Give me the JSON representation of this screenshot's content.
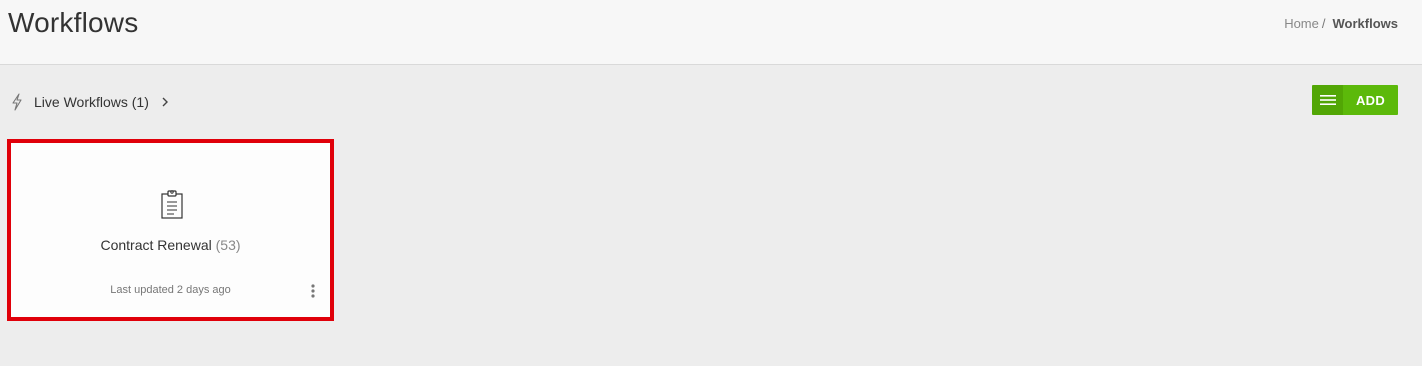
{
  "header": {
    "title": "Workflows",
    "breadcrumb": {
      "home": "Home",
      "separator": "/",
      "current": "Workflows"
    }
  },
  "toolbar": {
    "live_workflows_label": "Live Workflows (1)",
    "live_icon": "lightning-bolt-icon",
    "expand_icon": "chevron-right-icon",
    "add_label": "ADD",
    "add_icon": "hamburger-menu-icon"
  },
  "workflows": [
    {
      "name": "Contract Renewal",
      "count": "(53)",
      "updated": "Last updated 2 days ago",
      "icon": "clipboard-icon",
      "selected": true
    }
  ],
  "colors": {
    "accent_green": "#5cb90a",
    "accent_green_dark": "#52a605",
    "highlight_border": "#e0000a"
  }
}
